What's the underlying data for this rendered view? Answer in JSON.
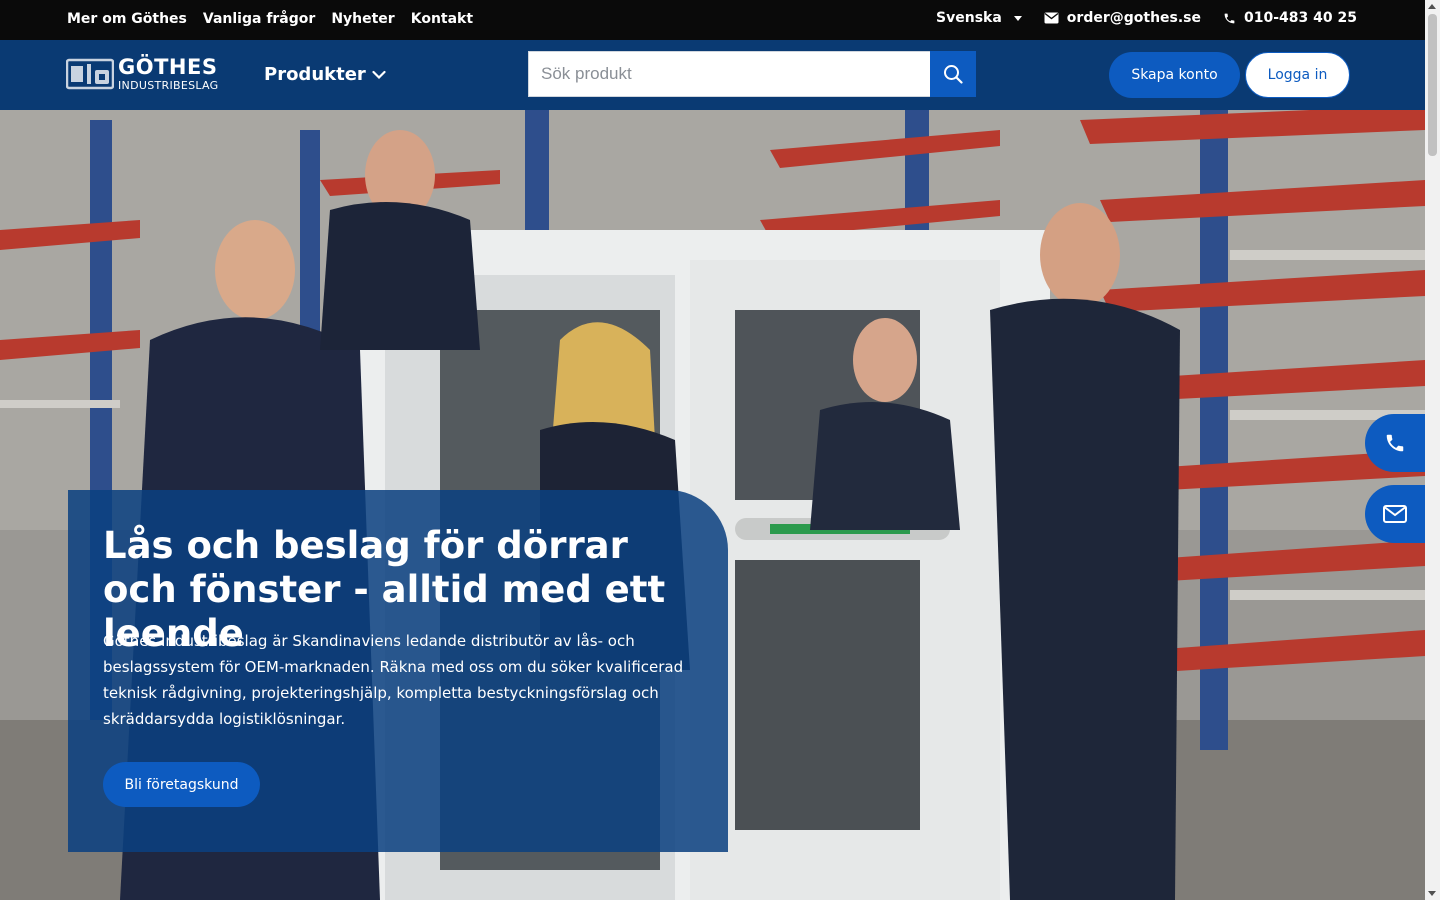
{
  "topbar": {
    "links": [
      "Mer om Göthes",
      "Vanliga frågor",
      "Nyheter",
      "Kontakt"
    ],
    "language": "Svenska",
    "email": "order@gothes.se",
    "phone": "010-483 40 25"
  },
  "header": {
    "logo_line1": "GÖTHES",
    "logo_line2": "INDUSTRIBESLAG",
    "products_label": "Produkter",
    "search_placeholder": "Sök produkt",
    "create_account": "Skapa konto",
    "login": "Logga in"
  },
  "hero": {
    "title": "Lås och beslag för dörrar och fönster - alltid med ett leende",
    "text": "Göthes Industribeslag är Skandinaviens ledande distributör av lås- och beslagssystem för OEM-marknaden. Räkna med oss om du söker kvalificerad teknisk rådgivning, projekteringshjälp, kompletta bestyckningsförslag och skräddarsydda logistiklösningar.",
    "cta": "Bli företagskund"
  },
  "icons": {
    "email": "envelope-icon",
    "phone": "phone-icon",
    "search": "search-icon",
    "float_phone": "phone-icon",
    "float_mail": "envelope-icon"
  },
  "colors": {
    "topbar": "#0a0a0a",
    "header": "#0a3a73",
    "accent": "#0d5bc0"
  }
}
